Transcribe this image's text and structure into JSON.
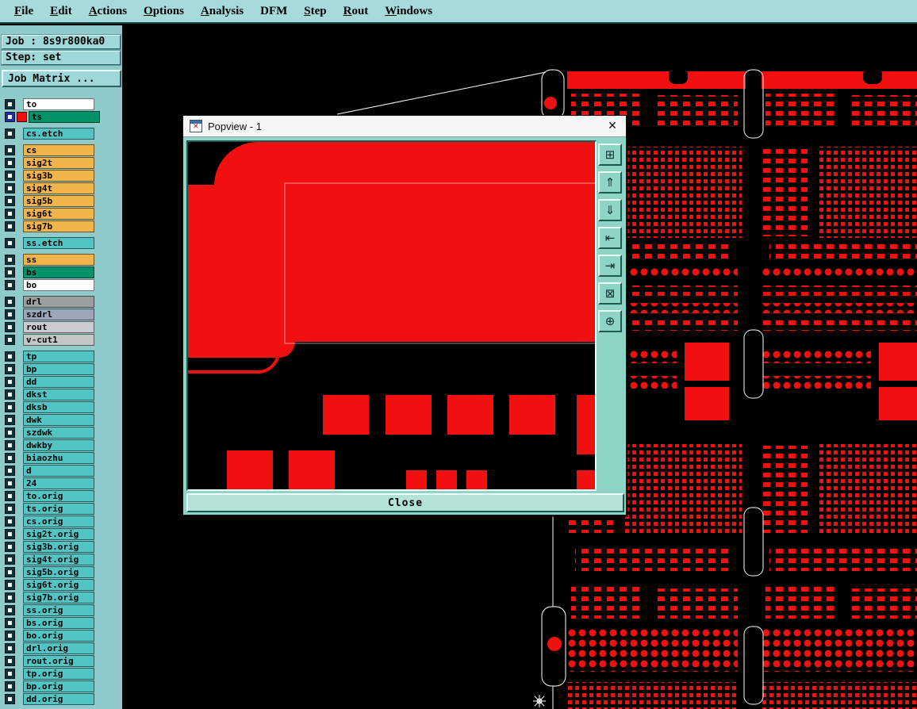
{
  "colors": {
    "red": "#f01010",
    "teal_menubar": "#a7dada",
    "teal_sidebar": "#8fcbcb",
    "teal_frame": "#8ed5c8",
    "outline_white": "#ffffff"
  },
  "menubar": {
    "items": [
      {
        "label": "File",
        "underline": 0
      },
      {
        "label": "Edit",
        "underline": 0
      },
      {
        "label": "Actions",
        "underline": 0
      },
      {
        "label": "Options",
        "underline": 0
      },
      {
        "label": "Analysis",
        "underline": 0
      },
      {
        "label": "DFM",
        "underline": -1
      },
      {
        "label": "Step",
        "underline": 0
      },
      {
        "label": "Rout",
        "underline": 0
      },
      {
        "label": "Windows",
        "underline": 0
      }
    ]
  },
  "sidebar": {
    "job_label": "Job : 8s9r800ka0",
    "step_label": "Step: set",
    "job_matrix_button": "Job Matrix ...",
    "layers": [
      {
        "name": "to",
        "color": "#ffffff"
      },
      {
        "name": "ts",
        "color": "#00936a",
        "active": true
      },
      {
        "name": "cs.etch",
        "color": "#53c4c4",
        "gap": true
      },
      {
        "name": "cs",
        "color": "#f0b44a",
        "gap": true
      },
      {
        "name": "sig2t",
        "color": "#f0b44a"
      },
      {
        "name": "sig3b",
        "color": "#f0b44a"
      },
      {
        "name": "sig4t",
        "color": "#f0b44a"
      },
      {
        "name": "sig5b",
        "color": "#f0b44a"
      },
      {
        "name": "sig6t",
        "color": "#f0b44a"
      },
      {
        "name": "sig7b",
        "color": "#f0b44a"
      },
      {
        "name": "ss.etch",
        "color": "#53c4c4",
        "gap": true
      },
      {
        "name": "ss",
        "color": "#f0b44a",
        "gap": true
      },
      {
        "name": "bs",
        "color": "#00936a"
      },
      {
        "name": "bo",
        "color": "#ffffff"
      },
      {
        "name": "drl",
        "color": "#9aa0a0",
        "gap": true
      },
      {
        "name": "szdrl",
        "color": "#9aa7b8"
      },
      {
        "name": "rout",
        "color": "#c9cdd1"
      },
      {
        "name": "v-cut1",
        "color": "#c4c8c4"
      },
      {
        "name": "tp",
        "color": "#53c4c4",
        "gap": true
      },
      {
        "name": "bp",
        "color": "#53c4c4"
      },
      {
        "name": "dd",
        "color": "#53c4c4"
      },
      {
        "name": "dkst",
        "color": "#53c4c4"
      },
      {
        "name": "dksb",
        "color": "#53c4c4"
      },
      {
        "name": "dwk",
        "color": "#53c4c4"
      },
      {
        "name": "szdwk",
        "color": "#53c4c4"
      },
      {
        "name": "dwkby",
        "color": "#53c4c4"
      },
      {
        "name": "biaozhu",
        "color": "#53c4c4"
      },
      {
        "name": "d",
        "color": "#53c4c4"
      },
      {
        "name": "24",
        "color": "#53c4c4"
      },
      {
        "name": "to.orig",
        "color": "#53c4c4"
      },
      {
        "name": "ts.orig",
        "color": "#53c4c4"
      },
      {
        "name": "cs.orig",
        "color": "#53c4c4"
      },
      {
        "name": "sig2t.orig",
        "color": "#53c4c4"
      },
      {
        "name": "sig3b.orig",
        "color": "#53c4c4"
      },
      {
        "name": "sig4t.orig",
        "color": "#53c4c4"
      },
      {
        "name": "sig5b.orig",
        "color": "#53c4c4"
      },
      {
        "name": "sig6t.orig",
        "color": "#53c4c4"
      },
      {
        "name": "sig7b.orig",
        "color": "#53c4c4"
      },
      {
        "name": "ss.orig",
        "color": "#53c4c4"
      },
      {
        "name": "bs.orig",
        "color": "#53c4c4"
      },
      {
        "name": "bo.orig",
        "color": "#53c4c4"
      },
      {
        "name": "drl.orig",
        "color": "#53c4c4"
      },
      {
        "name": "rout.orig",
        "color": "#53c4c4"
      },
      {
        "name": "tp.orig",
        "color": "#53c4c4"
      },
      {
        "name": "bp.orig",
        "color": "#53c4c4"
      },
      {
        "name": "dd.orig",
        "color": "#53c4c4"
      }
    ]
  },
  "popview": {
    "title": "Popview - 1",
    "close_glyph": "✕",
    "close_label": "Close",
    "toolbar": [
      {
        "name": "duplicate-view-button",
        "glyph": "⊞"
      },
      {
        "name": "scroll-up-button",
        "glyph": "⇑"
      },
      {
        "name": "scroll-down-button",
        "glyph": "⇓"
      },
      {
        "name": "pan-left-button",
        "glyph": "⇤"
      },
      {
        "name": "pan-right-button",
        "glyph": "⇥"
      },
      {
        "name": "zoom-fit-button",
        "glyph": "⊠"
      },
      {
        "name": "pan-center-button",
        "glyph": "⊕"
      }
    ]
  }
}
